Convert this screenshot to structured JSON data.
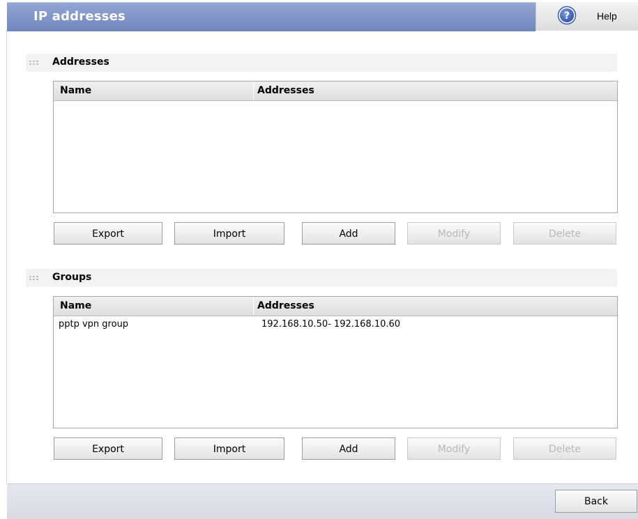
{
  "header": {
    "title": "IP addresses",
    "help_label": "Help",
    "help_icon": "question-circle-icon"
  },
  "addresses_section": {
    "title": "Addresses",
    "columns": {
      "name": "Name",
      "addresses": "Addresses"
    },
    "rows": [],
    "buttons": {
      "export": "Export",
      "import": "Import",
      "add": "Add",
      "modify": "Modify",
      "delete": "Delete"
    }
  },
  "groups_section": {
    "title": "Groups",
    "columns": {
      "name": "Name",
      "addresses": "Addresses"
    },
    "rows": [
      {
        "name": "pptp vpn group",
        "addresses": "192.168.10.50- 192.168.10.60"
      }
    ],
    "buttons": {
      "export": "Export",
      "import": "Import",
      "add": "Add",
      "modify": "Modify",
      "delete": "Delete"
    }
  },
  "footer": {
    "back_label": "Back"
  },
  "colors": {
    "title_bar": "#7f92c8",
    "disabled_text": "#b8b8b8"
  }
}
